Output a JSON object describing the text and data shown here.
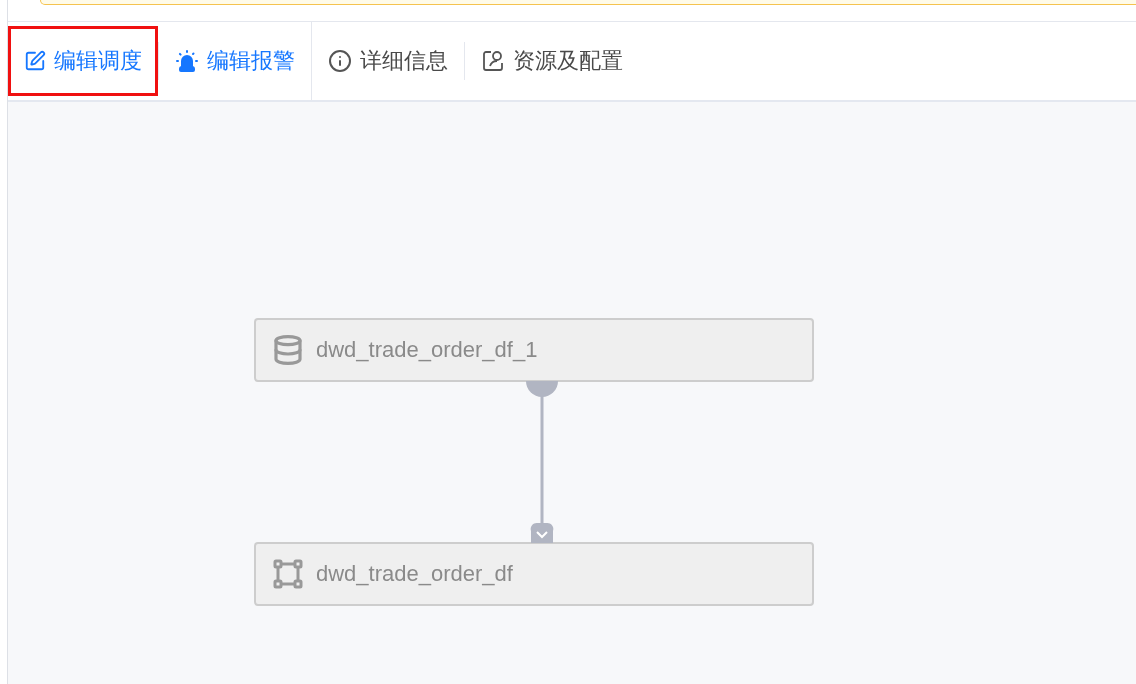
{
  "toolbar": {
    "groups": [
      {
        "items": [
          {
            "label": "编辑调度",
            "kind": "primary",
            "highlighted": true
          },
          {
            "label": "编辑报警",
            "kind": "primary",
            "highlighted": false
          }
        ]
      },
      {
        "items": [
          {
            "label": "详细信息",
            "kind": "plain",
            "highlighted": false
          },
          {
            "label": "资源及配置",
            "kind": "plain",
            "highlighted": false
          }
        ]
      }
    ]
  },
  "graph": {
    "nodes": [
      {
        "name": "dwd_trade_order_df_1",
        "kind": "table"
      },
      {
        "name": "dwd_trade_order_df",
        "kind": "task"
      }
    ]
  }
}
